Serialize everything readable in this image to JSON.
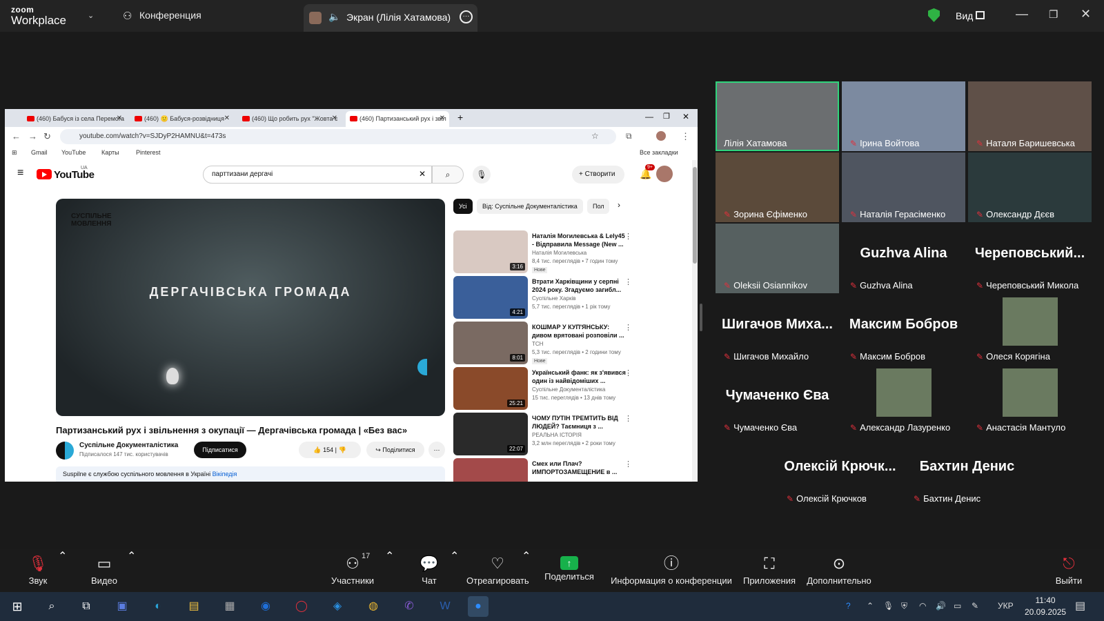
{
  "zoom": {
    "logo_top": "zoom",
    "logo_bottom": "Workplace",
    "conference_label": "Конференция",
    "share_label": "Экран (Лілія Хатамова)",
    "view_label": "Вид"
  },
  "browser": {
    "tabs": [
      {
        "label": "(460) Бабуся із села Перемога"
      },
      {
        "label": "(460) 🙂 Бабуся-розвідниця"
      },
      {
        "label": "(460) Що робить рух \"Жовта с"
      },
      {
        "label": "(460) Партизанський рух і звіл"
      }
    ],
    "url": "youtube.com/watch?v=SJDyP2HAMNU&t=473s",
    "bookmarks": [
      "Gmail",
      "YouTube",
      "Карты",
      "Pinterest"
    ],
    "all_bookmarks": "Все закладки"
  },
  "youtube": {
    "logo_text": "YouTube",
    "logo_region": "UA",
    "search_value": "парттизани дергачі",
    "create_label": "Створити",
    "notif_count": "9+",
    "video_brand": "СУСПІЛЬНЕ\nМОВЛЕННЯ",
    "video_overlay": "ДЕРГАЧІВСЬКА ГРОМАДА",
    "video_title": "Партизанський рух і звільнення з окупації — Дергачівська громада | «Без вас»",
    "channel_name": "Суспільне Документалістика",
    "channel_subs": "Підписалося 147 тис. користувачів",
    "subscribe_label": "Підписатися",
    "likes": "154",
    "share_label": "Поділитися",
    "desc_text": "Suspilne є службою суспільного мовлення в Україні",
    "desc_link": "Вікіпедія",
    "chips": [
      "Усі",
      "Від: Суспільне Документалістика",
      "Пол"
    ],
    "recs": [
      {
        "title": "Наталія Могилевська & Lely45 - Відправила Message (New ...",
        "channel": "Наталія Могилевська",
        "meta": "8,4 тис. переглядів • 7 годин тому",
        "badge": "Нове",
        "duration": "3:16",
        "color": "#d9c9c2"
      },
      {
        "title": "Втрати Харківщини у серпні 2024 року. Згадуємо загибл...",
        "channel": "Суспільне Харків",
        "meta": "5,7 тис. переглядів • 1 рік тому",
        "badge": "",
        "duration": "4:21",
        "color": "#3a5f9a"
      },
      {
        "title": "КОШМАР У КУП'ЯНСЬКУ: дивом врятовані розповіли ...",
        "channel": "ТСН",
        "meta": "5,3 тис. переглядів • 2 години тому",
        "badge": "Нове",
        "duration": "8:01",
        "color": "#7a6a62"
      },
      {
        "title": "Український фанк: як з'явився один із найвідоміших ...",
        "channel": "Суспільне Документалістика",
        "meta": "15 тис. переглядів • 13 днів тому",
        "badge": "",
        "duration": "25:21",
        "color": "#8a4a2a"
      },
      {
        "title": "ЧОМУ ПУТІН ТРЕМТИТЬ ВІД ЛЮДЕЙ? Таємниця з ...",
        "channel": "РЕАЛЬНА ІСТОРІЯ",
        "meta": "3,2 млн переглядів • 2 роки тому",
        "badge": "",
        "duration": "22:07",
        "color": "#2a2a2a"
      },
      {
        "title": "Смех или Плач? ИМПОРТОЗАМЕЩЕНИЕ в ...",
        "channel": "",
        "meta": "",
        "badge": "",
        "duration": "",
        "color": "#a34a4a"
      }
    ]
  },
  "participants": [
    {
      "name": "Лілія Хатамова",
      "big": "",
      "photo": true,
      "muted": false,
      "active": true
    },
    {
      "name": "Ірина Войтова",
      "big": "",
      "photo": true,
      "muted": true,
      "active": false
    },
    {
      "name": "Наталя Баришевська",
      "big": "",
      "photo": true,
      "muted": true,
      "active": false
    },
    {
      "name": "Зорина Єфіменко",
      "big": "",
      "photo": true,
      "muted": true,
      "active": false
    },
    {
      "name": "Наталія Герасіменко",
      "big": "",
      "photo": true,
      "muted": true,
      "active": false
    },
    {
      "name": "Олександр Дєєв",
      "big": "",
      "photo": true,
      "muted": true,
      "active": false
    },
    {
      "name": "Oleksii Osiannikov",
      "big": "",
      "photo": true,
      "muted": true,
      "active": false
    },
    {
      "name": "Guzhva Alina",
      "big": "Guzhva Alina",
      "photo": false,
      "muted": true,
      "active": false
    },
    {
      "name": "Череповський Микола",
      "big": "Череповський...",
      "photo": false,
      "muted": true,
      "active": false
    },
    {
      "name": "Шигачов Михайло",
      "big": "Шигачов Миха...",
      "photo": false,
      "muted": true,
      "active": false
    },
    {
      "name": "Максим Бобров",
      "big": "Максим Бобров",
      "photo": false,
      "muted": true,
      "active": false
    },
    {
      "name": "Олеся Корягіна",
      "big": "",
      "photo": "thumb",
      "muted": true,
      "active": false
    },
    {
      "name": "Чумаченко Єва",
      "big": "Чумаченко Єва",
      "photo": false,
      "muted": true,
      "active": false
    },
    {
      "name": "Александр Лазуренко",
      "big": "",
      "photo": "thumb",
      "muted": true,
      "active": false
    },
    {
      "name": "Анастасія Мантуло",
      "big": "",
      "photo": "thumb",
      "muted": true,
      "active": false
    },
    {
      "name": "Олексій Крючков",
      "big": "Олексій Крючк...",
      "photo": false,
      "muted": true,
      "active": false
    },
    {
      "name": "Бахтин Денис",
      "big": "Бахтин Денис",
      "photo": false,
      "muted": true,
      "active": false
    }
  ],
  "toolbar": {
    "audio": "Звук",
    "video": "Видео",
    "participants": "Участники",
    "participants_count": "17",
    "chat": "Чат",
    "react": "Отреагировать",
    "share": "Поделиться",
    "info": "Информация о конференции",
    "apps": "Приложения",
    "more": "Дополнительно",
    "leave": "Выйти"
  },
  "taskbar": {
    "lang": "УКР",
    "time": "11:40",
    "date": "20.09.2025"
  },
  "colors": {
    "accent_green": "#2fd47c",
    "mute_red": "#e0303c",
    "yt_red": "#ff0000"
  }
}
